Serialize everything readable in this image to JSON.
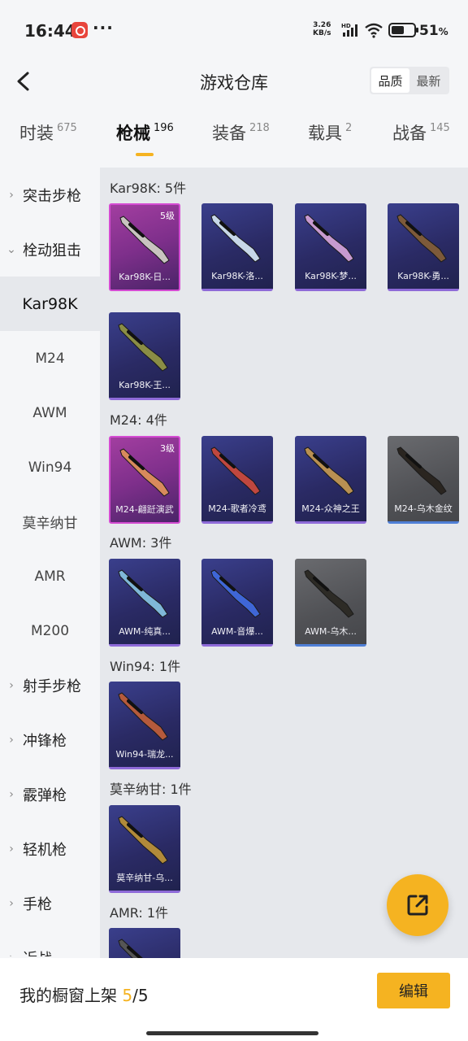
{
  "status": {
    "time": "16:44",
    "speed_value": "3.26",
    "speed_unit": "KB/s",
    "network_badge": "HD",
    "battery_pct": "51",
    "battery_unit": "%",
    "app_icon": "netease-app-icon",
    "more_icon": "ellipsis-icon"
  },
  "header": {
    "title": "游戏仓库",
    "sort": {
      "quality": "品质",
      "latest": "最新",
      "active": "quality"
    }
  },
  "tabs": [
    {
      "label": "时装",
      "count": "675",
      "active": false
    },
    {
      "label": "枪械",
      "count": "196",
      "active": true
    },
    {
      "label": "装备",
      "count": "218",
      "active": false
    },
    {
      "label": "载具",
      "count": "2",
      "active": false
    },
    {
      "label": "战备",
      "count": "145",
      "active": false
    }
  ],
  "sidebar": [
    {
      "label": "突击步枪",
      "type": "category",
      "expanded": false
    },
    {
      "label": "栓动狙击",
      "type": "category",
      "expanded": true
    },
    {
      "label": "Kar98K",
      "type": "sub",
      "selected": true
    },
    {
      "label": "M24",
      "type": "sub"
    },
    {
      "label": "AWM",
      "type": "sub"
    },
    {
      "label": "Win94",
      "type": "sub"
    },
    {
      "label": "莫辛纳甘",
      "type": "sub"
    },
    {
      "label": "AMR",
      "type": "sub"
    },
    {
      "label": "M200",
      "type": "sub"
    },
    {
      "label": "射手步枪",
      "type": "category"
    },
    {
      "label": "冲锋枪",
      "type": "category"
    },
    {
      "label": "霰弹枪",
      "type": "category"
    },
    {
      "label": "轻机枪",
      "type": "category"
    },
    {
      "label": "手枪",
      "type": "category"
    },
    {
      "label": "近战",
      "type": "category"
    }
  ],
  "groups": [
    {
      "title": "Kar98K: 5件",
      "items": [
        {
          "label": "Kar98K-日...",
          "rarity": "pink",
          "level": "5级",
          "gun_color": "#c9c4c0"
        },
        {
          "label": "Kar98K-洛...",
          "rarity": "purple",
          "gun_color": "#c7d7e8"
        },
        {
          "label": "Kar98K-梦...",
          "rarity": "purple",
          "gun_color": "#c79ad0"
        },
        {
          "label": "Kar98K-勇...",
          "rarity": "purple",
          "gun_color": "#7d5a3a"
        },
        {
          "label": "Kar98K-王...",
          "rarity": "purple",
          "gun_color": "#8a8d45"
        }
      ]
    },
    {
      "title": "M24: 4件",
      "items": [
        {
          "label": "M24-翩跹演武",
          "rarity": "pink",
          "level": "3级",
          "gun_color": "#d88a5c"
        },
        {
          "label": "M24-歌者冷鸢",
          "rarity": "purple",
          "gun_color": "#c0473f"
        },
        {
          "label": "M24-众神之王",
          "rarity": "purple",
          "gun_color": "#b99052"
        },
        {
          "label": "M24-乌木金纹",
          "rarity": "gray",
          "gun_color": "#2a2520"
        }
      ]
    },
    {
      "title": "AWM: 3件",
      "items": [
        {
          "label": "AWM-纯真...",
          "rarity": "purple",
          "gun_color": "#7fb7d8"
        },
        {
          "label": "AWM-音爆...",
          "rarity": "purple",
          "gun_color": "#3f66d6"
        },
        {
          "label": "AWM-乌木...",
          "rarity": "gray",
          "gun_color": "#2d2b26"
        }
      ]
    },
    {
      "title": "Win94: 1件",
      "items": [
        {
          "label": "Win94-瑞龙...",
          "rarity": "purple",
          "gun_color": "#b55a3c"
        }
      ]
    },
    {
      "title": "莫辛纳甘: 1件",
      "items": [
        {
          "label": "莫辛纳甘-乌...",
          "rarity": "purple",
          "gun_color": "#b18a3a"
        }
      ]
    },
    {
      "title": "AMR: 1件",
      "items": [
        {
          "label": "",
          "rarity": "purple",
          "gun_color": "#555"
        }
      ]
    }
  ],
  "bottom": {
    "shelf_label": "我的橱窗上架",
    "shelf_current": "5",
    "shelf_total": "/5",
    "edit_label": "编辑"
  },
  "colors": {
    "accent": "#f5b321",
    "pink_frame": "#d44bd2",
    "purple_bar": "#8e6ad8",
    "gray_bar": "#4f7fd6"
  }
}
